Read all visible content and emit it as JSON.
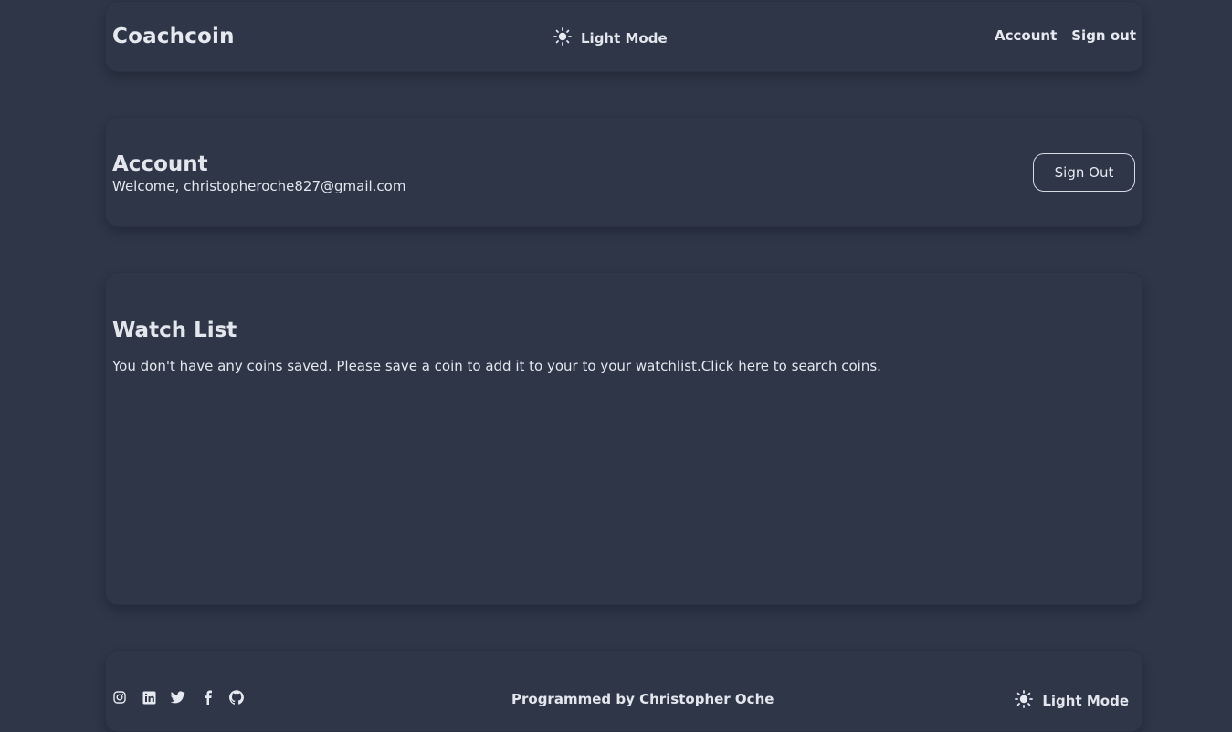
{
  "header": {
    "brand": "Coachcoin",
    "theme_label": "Light Mode",
    "nav": {
      "account": "Account",
      "signout": "Sign out"
    }
  },
  "account": {
    "title": "Account",
    "welcome": "Welcome, christopheroche827@gmail.com",
    "signout_button": "Sign Out"
  },
  "watchlist": {
    "title": "Watch List",
    "message": "You don't have any coins saved. Please save a coin to add it to your to your watchlist.",
    "link": "Click here to search coins."
  },
  "footer": {
    "socials": [
      "instagram-icon",
      "linkedin-icon",
      "twitter-icon",
      "facebook-icon",
      "github-icon"
    ],
    "credit": "Programmed by Christopher Oche",
    "theme_label": "Light Mode"
  }
}
